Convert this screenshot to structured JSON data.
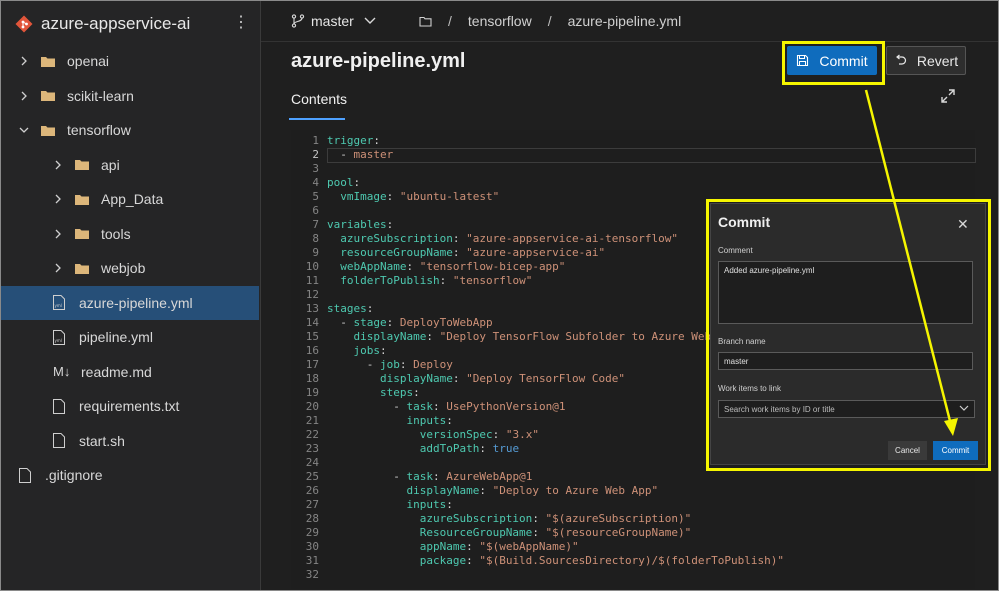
{
  "repo": {
    "name": "azure-appservice-ai"
  },
  "tree": [
    {
      "label": "openai",
      "type": "folder",
      "expanded": false,
      "indent": 0
    },
    {
      "label": "scikit-learn",
      "type": "folder",
      "expanded": false,
      "indent": 0
    },
    {
      "label": "tensorflow",
      "type": "folder",
      "expanded": true,
      "indent": 0
    },
    {
      "label": "api",
      "type": "folder",
      "expanded": false,
      "indent": 1
    },
    {
      "label": "App_Data",
      "type": "folder",
      "expanded": false,
      "indent": 1
    },
    {
      "label": "tools",
      "type": "folder",
      "expanded": false,
      "indent": 1
    },
    {
      "label": "webjob",
      "type": "folder",
      "expanded": false,
      "indent": 1
    },
    {
      "label": "azure-pipeline.yml",
      "type": "yml",
      "selected": true,
      "indent": 1
    },
    {
      "label": "pipeline.yml",
      "type": "yml",
      "indent": 1
    },
    {
      "label": "readme.md",
      "type": "md",
      "indent": 1
    },
    {
      "label": "requirements.txt",
      "type": "file",
      "indent": 1
    },
    {
      "label": "start.sh",
      "type": "file",
      "indent": 1
    },
    {
      "label": ".gitignore",
      "type": "file",
      "indent": 0
    }
  ],
  "topbar": {
    "branch": "master",
    "crumbs": [
      "tensorflow",
      "azure-pipeline.yml"
    ]
  },
  "file": {
    "title": "azure-pipeline.yml",
    "tab": "Contents"
  },
  "actions": {
    "commit": "Commit",
    "revert": "Revert"
  },
  "code": [
    "trigger:",
    "  - master",
    "",
    "pool:",
    "  vmImage: \"ubuntu-latest\"",
    "",
    "variables:",
    "  azureSubscription: \"azure-appservice-ai-tensorflow\"",
    "  resourceGroupName: \"azure-appservice-ai\"",
    "  webAppName: \"tensorflow-bicep-app\"",
    "  folderToPublish: \"tensorflow\"",
    "",
    "stages:",
    "  - stage: DeployToWebApp",
    "    displayName: \"Deploy TensorFlow Subfolder to Azure Web App\"",
    "    jobs:",
    "      - job: Deploy",
    "        displayName: \"Deploy TensorFlow Code\"",
    "        steps:",
    "          - task: UsePythonVersion@1",
    "            inputs:",
    "              versionSpec: \"3.x\"",
    "              addToPath: true",
    "",
    "          - task: AzureWebApp@1",
    "            displayName: \"Deploy to Azure Web App\"",
    "            inputs:",
    "              azureSubscription: \"$(azureSubscription)\"",
    "              ResourceGroupName: \"$(resourceGroupName)\"",
    "              appName: \"$(webAppName)\"",
    "              package: \"$(Build.SourcesDirectory)/$(folderToPublish)\"",
    ""
  ],
  "dialog": {
    "title": "Commit",
    "comment_label": "Comment",
    "comment_value": "Added azure-pipeline.yml",
    "branch_label": "Branch name",
    "branch_value": "master",
    "workitems_label": "Work items to link",
    "workitems_placeholder": "Search work items by ID or title",
    "cancel": "Cancel",
    "commit": "Commit"
  },
  "colors": {
    "accent": "#0f6cbd",
    "highlight": "#f5f500",
    "selected": "#264f78"
  }
}
